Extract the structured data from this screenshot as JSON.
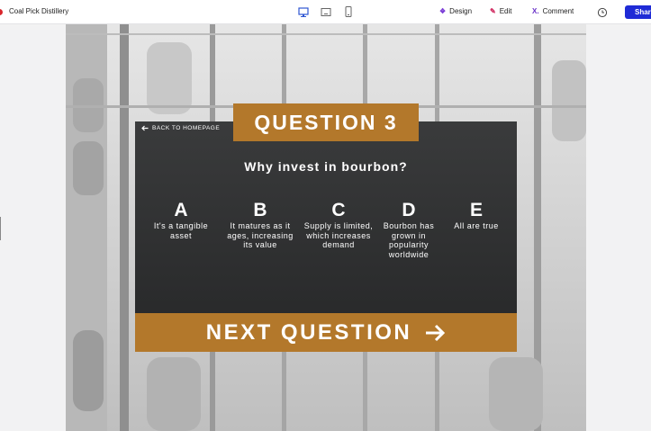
{
  "app": {
    "title": "Coal Pick Distillery"
  },
  "toolbar": {
    "devices": [
      "desktop-icon",
      "tablet-icon",
      "mobile-icon"
    ],
    "design_label": "Design",
    "edit_label": "Edit",
    "comment_label": "Comment",
    "share_label": "Share"
  },
  "quiz": {
    "question_number": "QUESTION 3",
    "back_label": "BACK TO HOMEPAGE",
    "question": "Why invest in bourbon?",
    "options": [
      {
        "letter": "A",
        "text": "It's a tangible asset"
      },
      {
        "letter": "B",
        "text": "It matures as it ages, increasing its value"
      },
      {
        "letter": "C",
        "text": "Supply is limited, which increases demand"
      },
      {
        "letter": "D",
        "text": "Bourbon has grown in popularity worldwide"
      },
      {
        "letter": "E",
        "text": "All are true"
      }
    ],
    "next_label": "NEXT QUESTION"
  },
  "colors": {
    "accent": "#b3782b",
    "card": "#2e2f30",
    "share": "#1f2bd6"
  }
}
